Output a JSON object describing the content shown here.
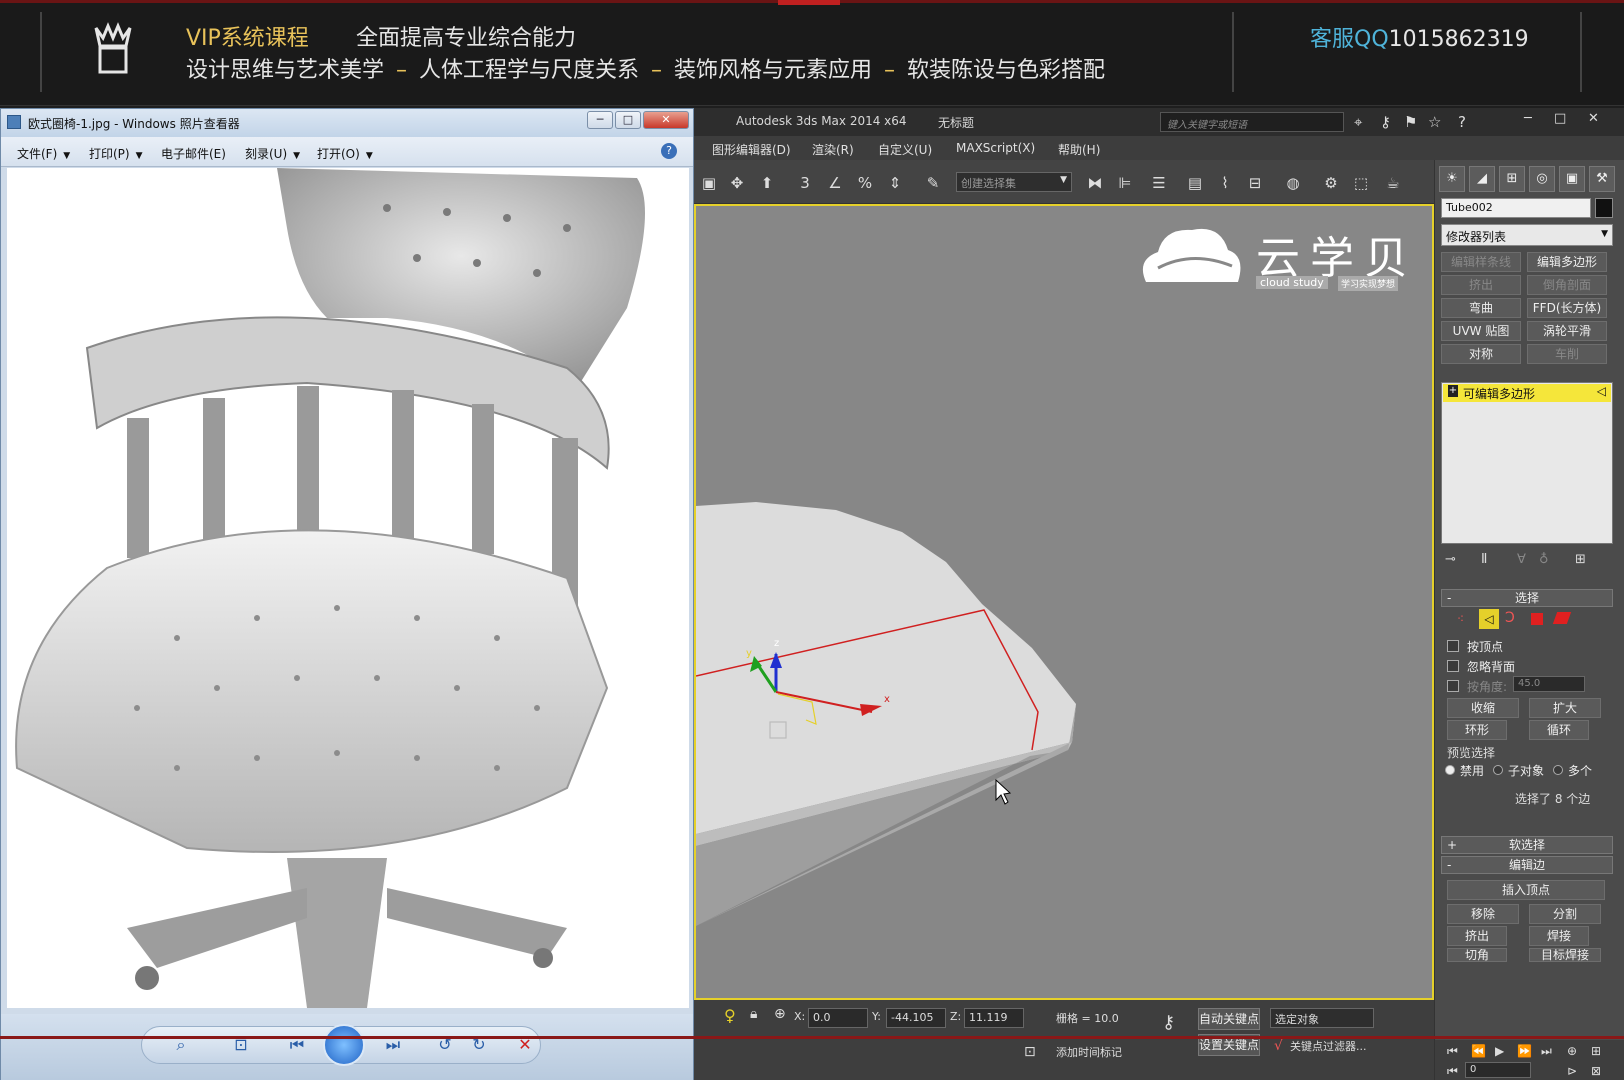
{
  "banner": {
    "title": "VIP系统课程",
    "subtitle": "全面提高专业综合能力",
    "topics": [
      "设计思维与艺术美学",
      "人体工程学与尺度关系",
      "装饰风格与元素应用",
      "软装陈设与色彩搭配"
    ],
    "topic_separator": "–",
    "qq_label": "客服QQ",
    "qq_number": "1015862319"
  },
  "viewer": {
    "title": "欧式圈椅-1.jpg - Windows 照片查看器",
    "window_buttons": {
      "minimize": "─",
      "maximize": "□",
      "close": "✕"
    },
    "menu": [
      "文件(F)",
      "打印(P)",
      "电子邮件(E)",
      "刻录(U)",
      "打开(O)"
    ],
    "help": "?",
    "controls": {
      "zoom": "⌕",
      "fit": "⊡",
      "prev": "⏮",
      "next": "⏭",
      "rotate_ccw": "↺",
      "rotate_cw": "↻",
      "delete": "✕"
    }
  },
  "max": {
    "app_title": "Autodesk 3ds Max  2014 x64",
    "doc_title": "无标题",
    "search_placeholder": "键入关键字或短语",
    "menu": [
      "图形编辑器(D)",
      "渲染(R)",
      "自定义(U)",
      "MAXScript(X)",
      "帮助(H)"
    ],
    "selection_set_placeholder": "创建选择集",
    "watermark": {
      "text": "云学贝",
      "sub": "cloud study",
      "tag": "学习实现梦想"
    },
    "status": {
      "x_label": "X:",
      "x_value": "0.0",
      "y_label": "Y:",
      "y_value": "-44.105",
      "z_label": "Z:",
      "z_value": "11.119",
      "grid": "栅格 = 10.0",
      "add_time_tag": "添加时间标记",
      "auto_key": "自动关键点",
      "set_key": "设置关键点",
      "selected_object": "选定对象",
      "key_filter": "关键点过滤器...",
      "frame": "0"
    },
    "axis_labels": {
      "z": "z",
      "y": "y",
      "x": "x"
    }
  },
  "command_panel": {
    "tabs": [
      "☀",
      "◢",
      "⊞",
      "◎",
      "▣",
      "⚒"
    ],
    "object_name": "Tube002",
    "modifier_list": "修改器列表",
    "modifier_buttons": [
      {
        "label": "编辑样条线",
        "enabled": false
      },
      {
        "label": "编辑多边形",
        "enabled": true
      },
      {
        "label": "挤出",
        "enabled": false
      },
      {
        "label": "倒角剖面",
        "enabled": false
      },
      {
        "label": "弯曲",
        "enabled": true
      },
      {
        "label": "FFD(长方体)",
        "enabled": true
      },
      {
        "label": "UVW 贴图",
        "enabled": true
      },
      {
        "label": "涡轮平滑",
        "enabled": true
      },
      {
        "label": "对称",
        "enabled": true
      },
      {
        "label": "车削",
        "enabled": false
      }
    ],
    "stack_item": "可编辑多边形",
    "selection_rollout": "选择",
    "by_vertex": "按顶点",
    "ignore_backface": "忽略背面",
    "by_angle": "按角度:",
    "angle_value": "45.0",
    "shrink": "收缩",
    "grow": "扩大",
    "ring": "环形",
    "loop": "循环",
    "preview_selection": "预览选择",
    "preview_options": [
      "禁用",
      "子对象",
      "多个"
    ],
    "selection_info": "选择了 8 个边",
    "soft_selection": "软选择",
    "edit_edges": "编辑边",
    "insert_vertex": "插入顶点",
    "remove": "移除",
    "split": "分割",
    "extrude": "挤出",
    "weld": "焊接",
    "chamfer": "切角",
    "target_weld": "目标焊接"
  },
  "colors": {
    "accent_gold": "#e8c25a",
    "qq_blue": "#4fb3d9",
    "viewport_border": "#e5d02a",
    "stack_highlight": "#f5e63a",
    "selected_edge": "#d02020"
  }
}
